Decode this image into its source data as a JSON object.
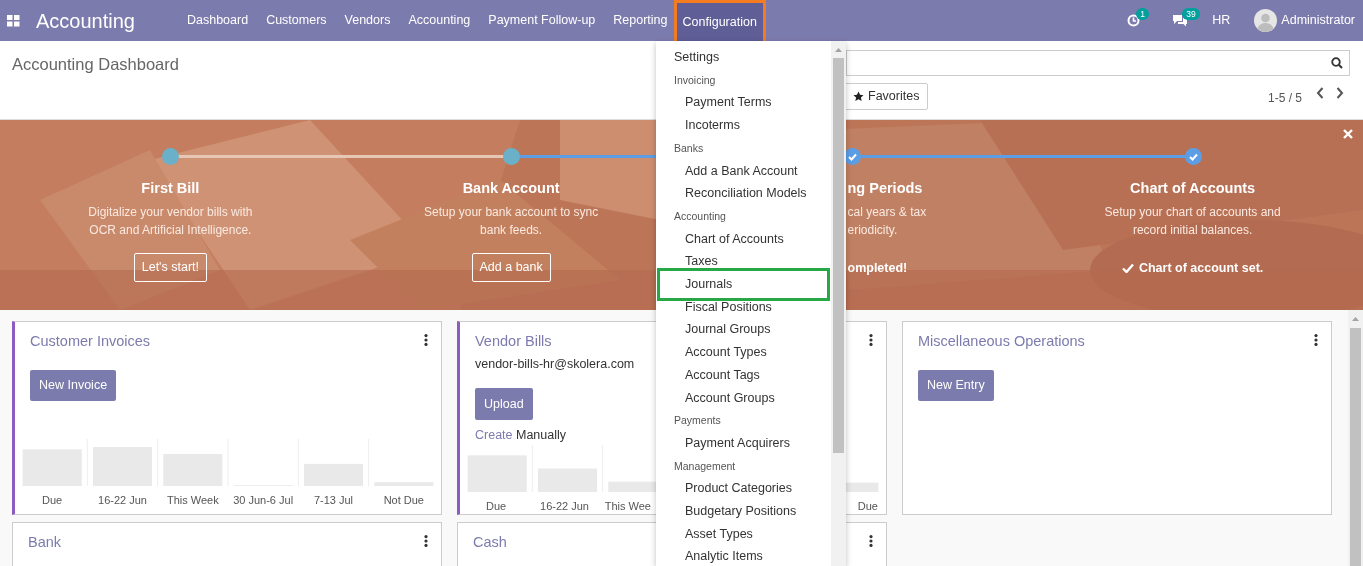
{
  "app_bar": {
    "app_name": "Accounting",
    "menu": [
      {
        "label": "Dashboard",
        "selected": false
      },
      {
        "label": "Customers",
        "selected": false
      },
      {
        "label": "Vendors",
        "selected": false
      },
      {
        "label": "Accounting",
        "selected": false
      },
      {
        "label": "Payment Follow-up",
        "selected": false
      },
      {
        "label": "Reporting",
        "selected": false
      },
      {
        "label": "Configuration",
        "selected": true,
        "highlighted": true
      }
    ],
    "activity_badge": "1",
    "messages_badge": "39",
    "company": "HR",
    "user": "Administrator"
  },
  "control_panel": {
    "breadcrumb": "Accounting Dashboard",
    "favorites": "Favorites",
    "pager": "1-5 / 5"
  },
  "onboarding": {
    "steps": [
      {
        "kind": "full",
        "done": false,
        "title": "First Bill",
        "description": [
          "Digitalize your vendor bills with",
          "OCR and Artificial Intelligence."
        ],
        "action": "Let's start!"
      },
      {
        "kind": "full",
        "done": false,
        "title": "Bank Account",
        "description": [
          "Setup your bank account to sync",
          "bank feeds."
        ],
        "action": "Add a bank"
      },
      {
        "kind": "partial",
        "done": true,
        "title": "ng Periods",
        "description": [
          "cal years & tax",
          "eriodicity."
        ],
        "status": "ompleted!"
      },
      {
        "kind": "full",
        "done": true,
        "title": "Chart of Accounts",
        "description": [
          "Setup your chart of accounts and",
          "record initial balances."
        ],
        "status": "Chart of account set."
      }
    ]
  },
  "cards": [
    {
      "title": "Customer Invoices",
      "accent": true,
      "button": "New Invoice",
      "chart_labels": [
        "Due",
        "16-22 Jun",
        "This Week",
        "30 Jun-6 Jul",
        "7-13 Jul",
        "Not Due"
      ]
    },
    {
      "title": "Vendor Bills",
      "accent": true,
      "email": "vendor-bills-hr@skolera.com",
      "button": "Upload",
      "link": "Create",
      "link_suffix": "Manually",
      "chart_labels": [
        "Due",
        "16-22 Jun",
        "This Wee",
        "Due"
      ]
    },
    {
      "title": "Miscellaneous Operations",
      "accent": false,
      "button": "New Entry"
    },
    {
      "title": "Bank",
      "accent": false
    },
    {
      "title": "Cash",
      "accent": false
    }
  ],
  "config_menu": {
    "items": [
      {
        "label": "Settings"
      },
      {
        "label": "Invoicing",
        "children": [
          {
            "label": "Payment Terms"
          },
          {
            "label": "Incoterms"
          }
        ]
      },
      {
        "label": "Banks",
        "children": [
          {
            "label": "Add a Bank Account"
          },
          {
            "label": "Reconciliation Models"
          }
        ]
      },
      {
        "label": "Accounting",
        "children": [
          {
            "label": "Chart of Accounts"
          },
          {
            "label": "Taxes"
          },
          {
            "label": "Journals",
            "highlighted": true
          },
          {
            "label": "Fiscal Positions"
          },
          {
            "label": "Journal Groups"
          },
          {
            "label": "Account Types"
          },
          {
            "label": "Account Tags"
          },
          {
            "label": "Account Groups"
          }
        ]
      },
      {
        "label": "Payments",
        "children": [
          {
            "label": "Payment Acquirers"
          }
        ]
      },
      {
        "label": "Management",
        "children": [
          {
            "label": "Product Categories"
          },
          {
            "label": "Budgetary Positions"
          },
          {
            "label": "Asset Types"
          },
          {
            "label": "Analytic Items"
          }
        ]
      }
    ]
  }
}
